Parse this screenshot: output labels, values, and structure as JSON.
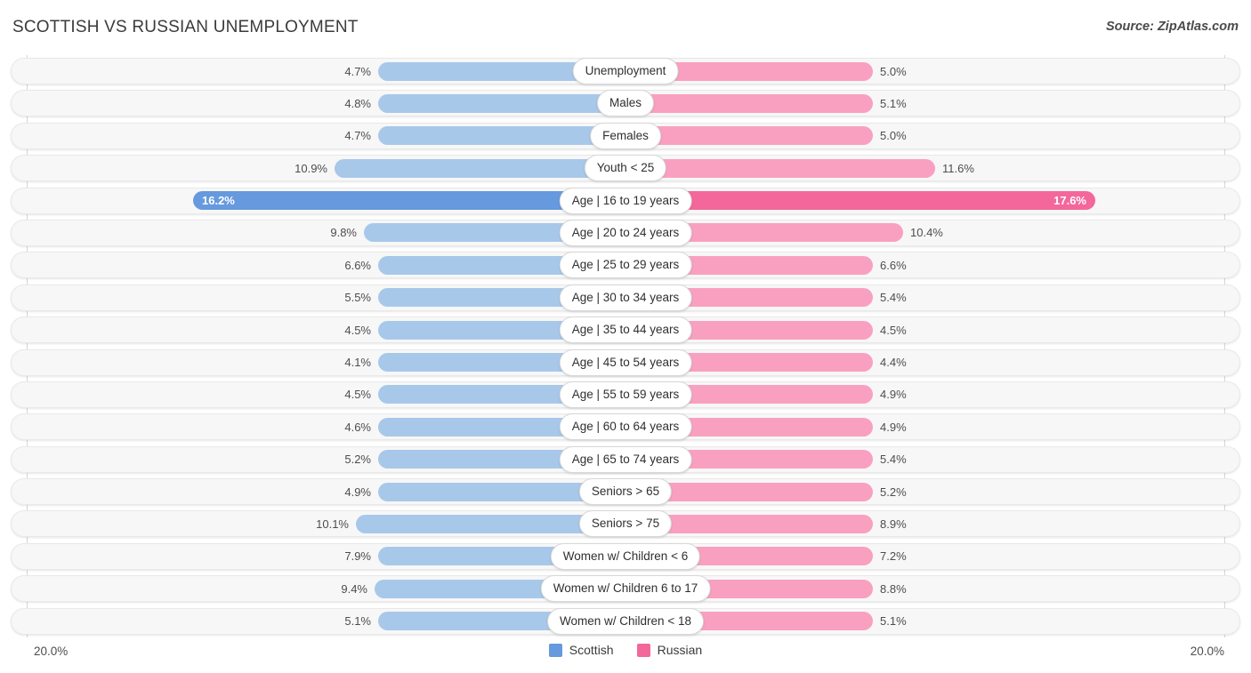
{
  "header": {
    "title": "SCOTTISH VS RUSSIAN UNEMPLOYMENT",
    "source": "Source: ZipAtlas.com"
  },
  "footer": {
    "axis_left": "20.0%",
    "axis_right": "20.0%",
    "legend": [
      {
        "label": "Scottish",
        "color": "#6699dd"
      },
      {
        "label": "Russian",
        "color": "#f4679a"
      }
    ]
  },
  "chart_data": {
    "type": "bar",
    "subtype": "diverging-bidirectional",
    "title": "SCOTTISH VS RUSSIAN UNEMPLOYMENT",
    "xlabel": "",
    "ylabel": "",
    "xlim": [
      20.0,
      20.0
    ],
    "axis_max": 20.0,
    "unit": "%",
    "grid": false,
    "legend_position": "bottom-center",
    "categories": [
      "Unemployment",
      "Males",
      "Females",
      "Youth < 25",
      "Age | 16 to 19 years",
      "Age | 20 to 24 years",
      "Age | 25 to 29 years",
      "Age | 30 to 34 years",
      "Age | 35 to 44 years",
      "Age | 45 to 54 years",
      "Age | 55 to 59 years",
      "Age | 60 to 64 years",
      "Age | 65 to 74 years",
      "Seniors > 65",
      "Seniors > 75",
      "Women w/ Children < 6",
      "Women w/ Children 6 to 17",
      "Women w/ Children < 18"
    ],
    "series": [
      {
        "name": "Scottish",
        "side": "left",
        "color": "#a8c8ea",
        "highlight_color": "#6699dd",
        "values": [
          4.7,
          4.8,
          4.7,
          10.9,
          16.2,
          9.8,
          6.6,
          5.5,
          4.5,
          4.1,
          4.5,
          4.6,
          5.2,
          4.9,
          10.1,
          7.9,
          9.4,
          5.1
        ],
        "labels": [
          "4.7%",
          "4.8%",
          "4.7%",
          "10.9%",
          "16.2%",
          "9.8%",
          "6.6%",
          "5.5%",
          "4.5%",
          "4.1%",
          "4.5%",
          "4.6%",
          "5.2%",
          "4.9%",
          "10.1%",
          "7.9%",
          "9.4%",
          "5.1%"
        ]
      },
      {
        "name": "Russian",
        "side": "right",
        "color": "#f9a0c0",
        "highlight_color": "#f4679a",
        "values": [
          5.0,
          5.1,
          5.0,
          11.6,
          17.6,
          10.4,
          6.6,
          5.4,
          4.5,
          4.4,
          4.9,
          4.9,
          5.4,
          5.2,
          8.9,
          7.2,
          8.8,
          5.1
        ],
        "labels": [
          "5.0%",
          "5.1%",
          "5.0%",
          "11.6%",
          "17.6%",
          "10.4%",
          "6.6%",
          "5.4%",
          "4.5%",
          "4.4%",
          "4.9%",
          "4.9%",
          "5.4%",
          "5.2%",
          "8.9%",
          "7.2%",
          "8.8%",
          "5.1%"
        ]
      }
    ],
    "highlight_row_index": 4
  }
}
